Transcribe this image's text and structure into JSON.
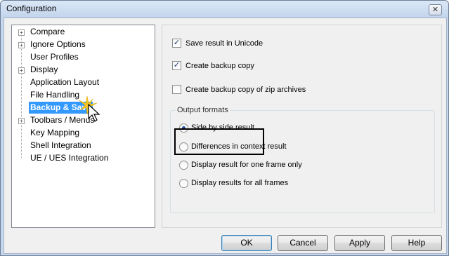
{
  "window": {
    "title": "Configuration",
    "close_glyph": "✕"
  },
  "tree": {
    "items": [
      {
        "label": "Compare",
        "expandable": true,
        "selected": false
      },
      {
        "label": "Ignore Options",
        "expandable": true,
        "selected": false
      },
      {
        "label": "User Profiles",
        "expandable": false,
        "selected": false
      },
      {
        "label": "Display",
        "expandable": true,
        "selected": false
      },
      {
        "label": "Application Layout",
        "expandable": false,
        "selected": false
      },
      {
        "label": "File Handling",
        "expandable": false,
        "selected": false
      },
      {
        "label": "Backup & Save",
        "expandable": false,
        "selected": true
      },
      {
        "label": "Toolbars / Menus",
        "expandable": true,
        "selected": false
      },
      {
        "label": "Key Mapping",
        "expandable": false,
        "selected": false
      },
      {
        "label": "Shell Integration",
        "expandable": false,
        "selected": false
      },
      {
        "label": "UE / UES Integration",
        "expandable": false,
        "selected": false
      }
    ]
  },
  "options": {
    "save_unicode": {
      "label": "Save result in Unicode",
      "checked": true
    },
    "backup_copy": {
      "label": "Create backup copy",
      "checked": true
    },
    "backup_zip": {
      "label": "Create backup copy of zip archives",
      "checked": false
    }
  },
  "output_formats": {
    "legend": "Output formats",
    "options": [
      {
        "label": "Side by side result",
        "selected": true
      },
      {
        "label": "Differences in context result",
        "selected": false
      },
      {
        "label": "Display result for one frame only",
        "selected": false
      },
      {
        "label": "Display results for all frames",
        "selected": false
      }
    ]
  },
  "buttons": {
    "ok": "OK",
    "cancel": "Cancel",
    "apply": "Apply",
    "help": "Help"
  },
  "colors": {
    "selection": "#3399ff",
    "title_bar": "#c3d5ec"
  },
  "icons": {
    "cursor": "hand-pointer-icon",
    "expander": "plus-expander-icon"
  }
}
